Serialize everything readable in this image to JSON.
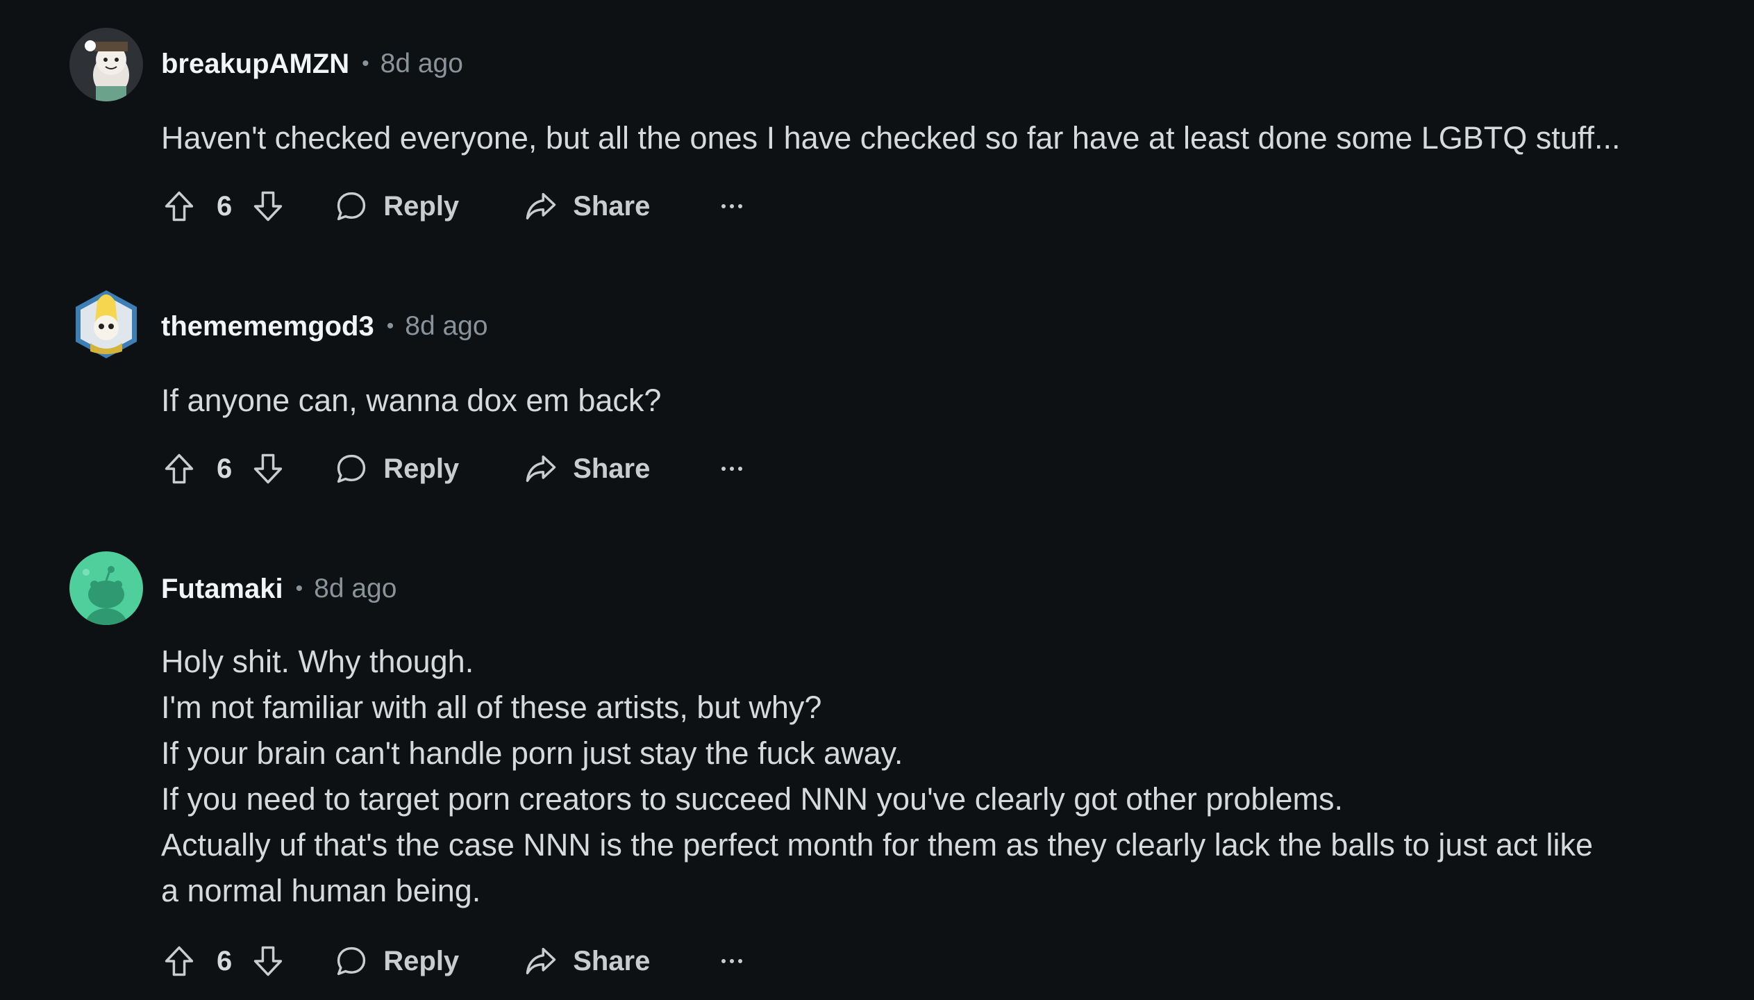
{
  "comments": [
    {
      "username": "breakupAMZN",
      "separator": "•",
      "time": "8d ago",
      "lines": [
        "Haven't checked everyone, but all the ones I have checked so far have at least done some LGBTQ stuff..."
      ],
      "score": "6",
      "avatar": "snoo-avatar-cat-girl"
    },
    {
      "username": "themememgod3",
      "separator": "•",
      "time": "8d ago",
      "lines": [
        "If anyone can, wanna dox em back?"
      ],
      "score": "6",
      "avatar": "snoo-avatar-hexagon-banana"
    },
    {
      "username": "Futamaki",
      "separator": "•",
      "time": "8d ago",
      "lines": [
        "Holy shit. Why though.",
        "I'm not familiar with all of these artists, but why?",
        "If your brain can't handle porn just stay the fuck away.",
        "If you need to target porn creators to succeed NNN you've clearly got other problems.",
        "Actually uf that's the case NNN is the perfect month for them as they clearly lack the balls to just act like",
        "a normal human being."
      ],
      "score": "6",
      "avatar": "default-snoo-avatar"
    }
  ],
  "actions": {
    "reply_label": "Reply",
    "share_label": "Share",
    "upvote_icon": "upvote-arrow-icon",
    "downvote_icon": "downvote-arrow-icon",
    "reply_icon": "speech-bubble-icon",
    "share_icon": "share-arrow-icon",
    "more_icon": "ellipsis-icon"
  },
  "colors": {
    "background": "#0e1113",
    "text": "#d7dadc",
    "username": "#f2f4f5",
    "muted": "#8a9399",
    "default_avatar": "#4ecf9b"
  }
}
